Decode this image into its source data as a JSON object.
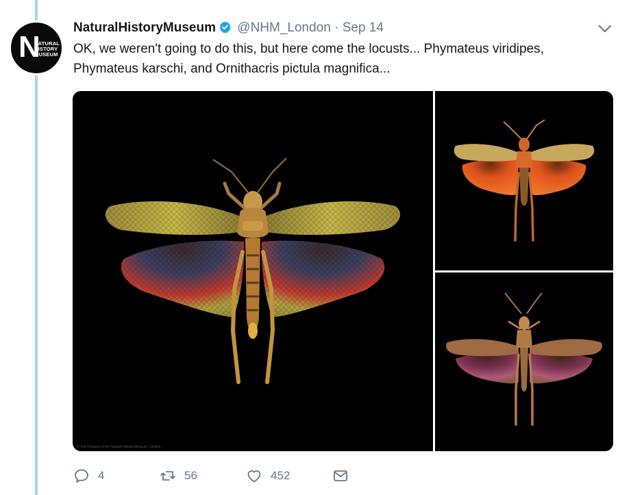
{
  "tweet": {
    "author_name": "NaturalHistoryMuseum",
    "handle": "@NHM_London",
    "separator": "·",
    "date": "Sep 14",
    "text_line1": "OK, we weren't going to do this, but here come the locusts... Phymateus viridipes,",
    "text_line2": "Phymateus karschi, and Ornithacris pictula magnifica..."
  },
  "avatar": {
    "logo_letter": "N",
    "logo_lines": [
      "NATURAL",
      "HISTORY",
      "MUSEUM"
    ]
  },
  "media": {
    "main_credit": "© The Trustees of the Natural History Museum, London",
    "background_color": "#000000",
    "images": [
      "locust-green-red",
      "locust-orange",
      "locust-brown-purple"
    ]
  },
  "actions": {
    "reply_count": "4",
    "retweet_count": "56",
    "like_count": "452"
  },
  "icons": {
    "verified": "verified-badge-icon",
    "chevron": "chevron-down-icon",
    "reply": "reply-icon",
    "retweet": "retweet-icon",
    "like": "heart-icon",
    "dm": "envelope-icon"
  },
  "colors": {
    "verified_blue": "#1da1f2",
    "thread_line": "#a8d9e0",
    "meta_gray": "#657786"
  }
}
